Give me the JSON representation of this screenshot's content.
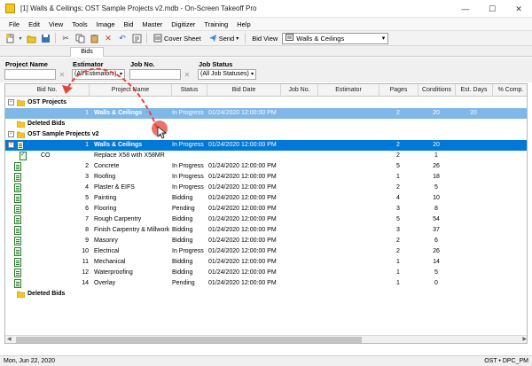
{
  "window": {
    "title": "[1] Walls & Ceilings; OST Sample Projects v2.mdb - On-Screen Takeoff Pro",
    "minimize": "—",
    "maximize": "☐",
    "close": "✕"
  },
  "menu": [
    "File",
    "Edit",
    "View",
    "Tools",
    "Image",
    "Bid",
    "Master",
    "Digitizer",
    "Training",
    "Help"
  ],
  "toolbar": {
    "cover_sheet_label": "Cover Sheet",
    "send_label": "Send",
    "bid_view_label": "Bid View",
    "bid_view_value": "Walls & Ceilings"
  },
  "tabs": {
    "bids": "Bids"
  },
  "filters": {
    "project_name_label": "Project Name",
    "estimator_label": "Estimator",
    "estimator_value": "(All Estimators)",
    "job_no_label": "Job No.",
    "job_status_label": "Job Status",
    "job_status_value": "(All Job Statuses)"
  },
  "columns": [
    "Bid No.",
    "Project Name",
    "Status",
    "Bid Date",
    "Job No.",
    "Estimator",
    "Pages",
    "Conditions",
    "Est. Days",
    "% Comp."
  ],
  "tree": {
    "group1_name": "OST Projects",
    "group1_row": {
      "num": "1",
      "name": "Walls & Ceilings",
      "status": "In Progress",
      "date": "01/24/2020 12:00:00 PM",
      "pages": "2",
      "conditions": "20"
    },
    "group1_deleted": "Deleted Bids",
    "group2_name": "OST Sample Projects v2",
    "group2_deleted": "Deleted Bids"
  },
  "rows": [
    {
      "num": "1",
      "name": "Walls & Ceilings",
      "status": "In Progress",
      "date": "01/24/2020 12:00:00 PM",
      "pages": "2",
      "conditions": "20",
      "days": ""
    },
    {
      "num": "CO",
      "name": "Replace X58 with X58MR",
      "status": "",
      "date": "",
      "pages": "2",
      "conditions": "1",
      "days": ""
    },
    {
      "num": "2",
      "name": "Concrete",
      "status": "In Progress",
      "date": "01/24/2020 12:00:00 PM",
      "pages": "5",
      "conditions": "26",
      "days": ""
    },
    {
      "num": "3",
      "name": "Roofing",
      "status": "In Progress",
      "date": "01/24/2020 12:00:00 PM",
      "pages": "1",
      "conditions": "18",
      "days": ""
    },
    {
      "num": "4",
      "name": "Plaster & EIFS",
      "status": "In Progress",
      "date": "01/24/2020 12:00:00 PM",
      "pages": "2",
      "conditions": "5",
      "days": ""
    },
    {
      "num": "5",
      "name": "Painting",
      "status": "Bidding",
      "date": "01/24/2020 12:00:00 PM",
      "pages": "4",
      "conditions": "10",
      "days": ""
    },
    {
      "num": "6",
      "name": "Flooring",
      "status": "Pending",
      "date": "01/24/2020 12:00:00 PM",
      "pages": "3",
      "conditions": "8",
      "days": ""
    },
    {
      "num": "7",
      "name": "Rough Carpentry",
      "status": "Bidding",
      "date": "01/24/2020 12:00:00 PM",
      "pages": "5",
      "conditions": "54",
      "days": ""
    },
    {
      "num": "8",
      "name": "Finish Carpentry & Millwork",
      "status": "Bidding",
      "date": "01/24/2020 12:00:00 PM",
      "pages": "3",
      "conditions": "37",
      "days": ""
    },
    {
      "num": "9",
      "name": "Masonry",
      "status": "Bidding",
      "date": "01/24/2020 12:00:00 PM",
      "pages": "2",
      "conditions": "6",
      "days": ""
    },
    {
      "num": "10",
      "name": "Electrical",
      "status": "In Progress",
      "date": "01/24/2020 12:00:00 PM",
      "pages": "2",
      "conditions": "26",
      "days": ""
    },
    {
      "num": "11",
      "name": "Mechanical",
      "status": "Bidding",
      "date": "01/24/2020 12:00:00 PM",
      "pages": "1",
      "conditions": "14",
      "days": ""
    },
    {
      "num": "12",
      "name": "Waterproofing",
      "status": "Bidding",
      "date": "01/24/2020 12:00:00 PM",
      "pages": "1",
      "conditions": "5",
      "days": ""
    },
    {
      "num": "14",
      "name": "Overlay",
      "status": "Pending",
      "date": "01/24/2020 12:00:00 PM",
      "pages": "1",
      "conditions": "0",
      "days": ""
    }
  ],
  "group1_days": "20",
  "status_bar": {
    "date": "Mon, Jun 22, 2020",
    "user": "OST • DPC_PM"
  },
  "colors": {
    "selection": "#0078d7",
    "selection_light": "#7fb7e8",
    "annotation": "#e2463a"
  }
}
